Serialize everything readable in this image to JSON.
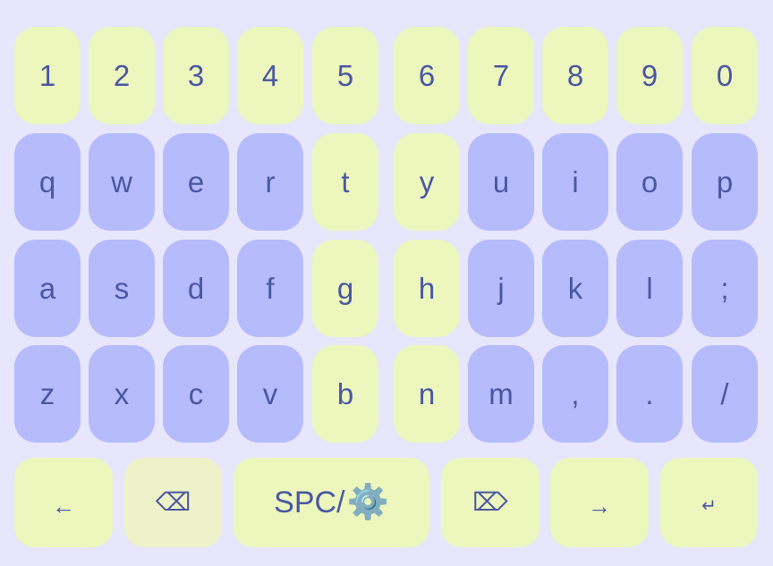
{
  "colors": {
    "background": "#e8e6fc",
    "key_yellow": "#ecf6bd",
    "key_blue": "#b6bbfb",
    "key_text": "#4a57a3"
  },
  "keys": {
    "row1": [
      "1",
      "2",
      "3",
      "4",
      "5",
      "6",
      "7",
      "8",
      "9",
      "0"
    ],
    "row2": [
      "q",
      "w",
      "e",
      "r",
      "t",
      "y",
      "u",
      "i",
      "o",
      "p"
    ],
    "row3": [
      "a",
      "s",
      "d",
      "f",
      "g",
      "h",
      "j",
      "k",
      "l",
      ";"
    ],
    "row4": [
      "z",
      "x",
      "c",
      "v",
      "b",
      "n",
      "m",
      ",",
      ".",
      "/"
    ]
  },
  "bottom_row": {
    "left_arrow": "←",
    "backspace": "⌫",
    "space_label": "SPC/",
    "space_icon": "⚙️",
    "delete": "⌦",
    "right_arrow": "→",
    "enter": "↵"
  },
  "icons": {
    "left_arrow": "left-arrow-icon",
    "backspace": "backspace-icon",
    "settings": "gear-icon",
    "delete": "delete-forward-icon",
    "right_arrow": "right-arrow-icon",
    "enter": "enter-icon"
  }
}
